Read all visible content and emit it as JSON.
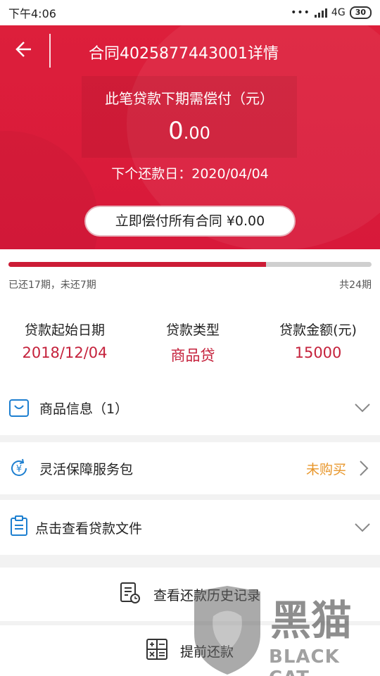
{
  "status_bar": {
    "time": "下午4:06",
    "network": "4G",
    "battery": "30"
  },
  "header": {
    "title": "合同4025877443001详情",
    "due_label": "此笔贷款下期需偿付（元）",
    "due_amount_int": "0",
    "due_amount_dec": ".00",
    "next_date_label": "下个还款日：2020/04/04",
    "pay_all_button": "立即偿付所有合同 ¥0.00"
  },
  "progress": {
    "paid_text": "已还17期，未还7期",
    "total_text": "共24期",
    "paid_periods": 17,
    "total_periods": 24
  },
  "loan_info": [
    {
      "label": "贷款起始日期",
      "value": "2018/12/04"
    },
    {
      "label": "贷款类型",
      "value": "商品贷"
    },
    {
      "label": "贷款金额(元)",
      "value": "15000"
    }
  ],
  "rows": {
    "product_info": "商品信息（1）",
    "service_pack": "灵活保障服务包",
    "service_status": "未购买",
    "loan_docs": "点击查看贷款文件"
  },
  "actions": {
    "history": "查看还款历史记录",
    "prepay": "提前还款"
  },
  "watermark": {
    "brand_cn": "黑猫",
    "brand_en": "BLACK CAT"
  },
  "colors": {
    "brand_red": "#d8193a",
    "accent_blue": "#1d7fd0",
    "status_orange": "#e8962a"
  }
}
